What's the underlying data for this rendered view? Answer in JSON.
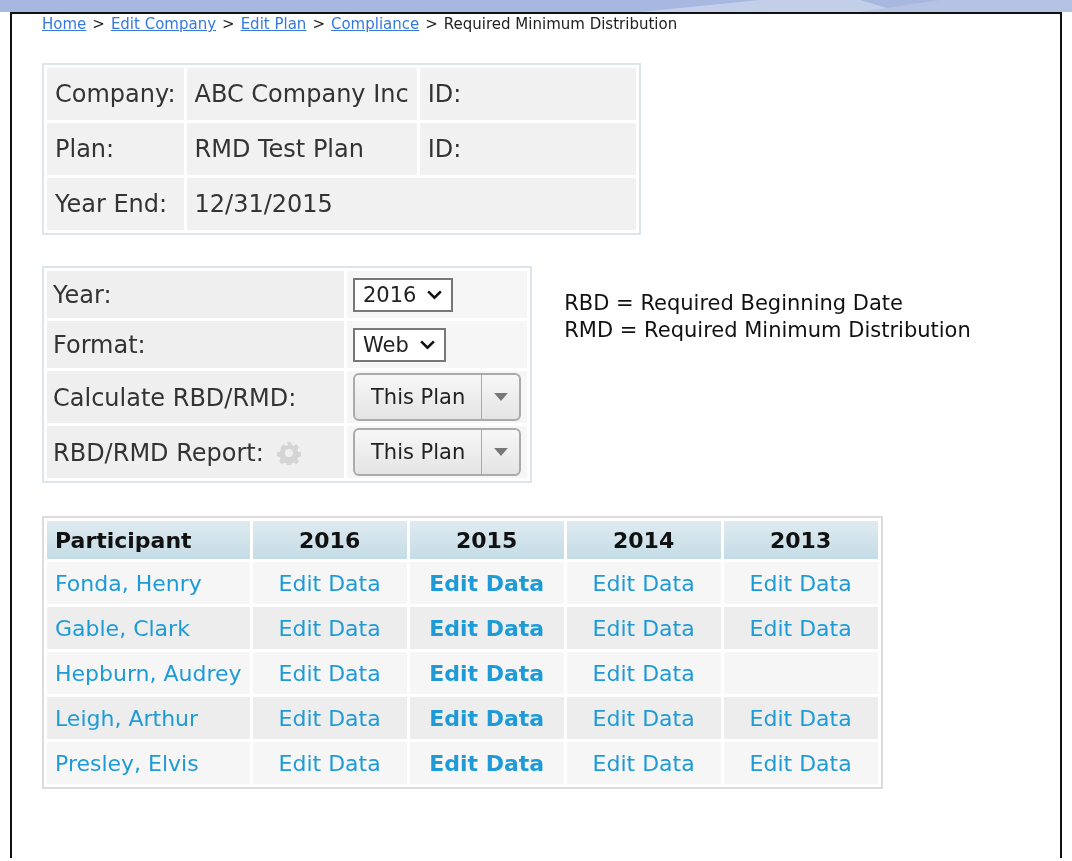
{
  "breadcrumb": {
    "links": [
      {
        "label": "Home",
        "separator": ">"
      },
      {
        "label": "Edit Company",
        "separator": ">"
      },
      {
        "label": "Edit Plan",
        "separator": ">"
      },
      {
        "label": "Compliance",
        "separator": ">"
      }
    ],
    "current": "Required Minimum Distribution"
  },
  "info": [
    {
      "label": "Company:",
      "value": "ABC Company Inc",
      "id_label": "ID:"
    },
    {
      "label": "Plan:",
      "value": "RMD Test Plan",
      "id_label": "ID:"
    },
    {
      "label": "Year End:",
      "value": "12/31/2015"
    }
  ],
  "settings": [
    {
      "kind": "select",
      "label": "Year:",
      "value": "2016"
    },
    {
      "kind": "select",
      "label": "Format:",
      "value": "Web"
    },
    {
      "kind": "split",
      "label": "Calculate RBD/RMD:",
      "value": "This Plan"
    },
    {
      "kind": "split",
      "label": "RBD/RMD Report:",
      "value": "This Plan",
      "gear": true
    }
  ],
  "legend": [
    "RBD = Required Beginning Date",
    "RMD = Required Minimum Distribution"
  ],
  "table": {
    "columns": [
      {
        "label": "Participant",
        "emphasized": false
      },
      {
        "label": "2016",
        "emphasized": false
      },
      {
        "label": "2015",
        "emphasized": true
      },
      {
        "label": "2014",
        "emphasized": false
      },
      {
        "label": "2013",
        "emphasized": false
      }
    ],
    "rows": [
      {
        "cells": [
          "Fonda, Henry",
          "Edit Data",
          "Edit Data",
          "Edit Data",
          "Edit Data"
        ]
      },
      {
        "cells": [
          "Gable, Clark",
          "Edit Data",
          "Edit Data",
          "Edit Data",
          "Edit Data"
        ]
      },
      {
        "cells": [
          "Hepburn, Audrey",
          "Edit Data",
          "Edit Data",
          "Edit Data",
          ""
        ]
      },
      {
        "cells": [
          "Leigh, Arthur",
          "Edit Data",
          "Edit Data",
          "Edit Data",
          "Edit Data"
        ]
      },
      {
        "cells": [
          "Presley, Elvis",
          "Edit Data",
          "Edit Data",
          "Edit Data",
          "Edit Data"
        ]
      }
    ]
  }
}
